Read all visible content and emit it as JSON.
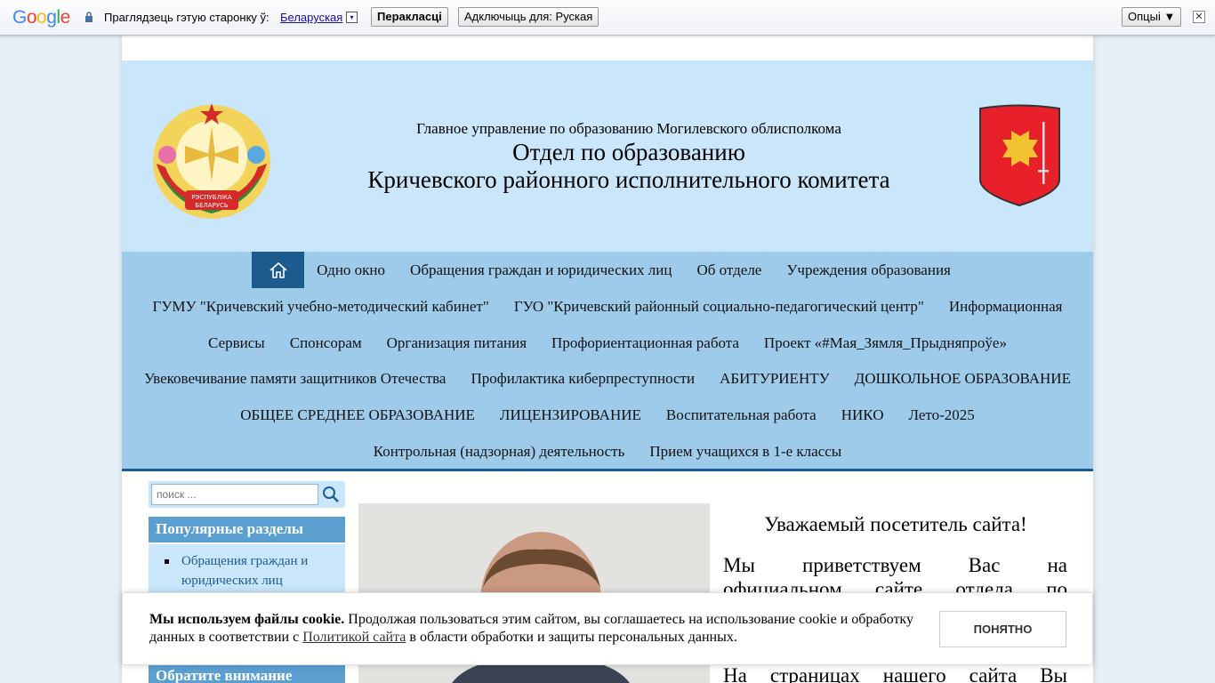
{
  "translate_bar": {
    "logo": "Google",
    "prompt": "Праглядзець гэтую старонку ў:",
    "language": "Беларуская",
    "language_drop": "▾",
    "translate_button": "Перакласці",
    "disable_button": "Адключыць для: Руская",
    "options_button": "Опцыі ▼",
    "close": "✕"
  },
  "header": {
    "subtitle": "Главное управление по образованию Могилевского облисполкома",
    "title_line1": "Отдел по образованию",
    "title_line2": "Кричевского районного исполнительного комитета",
    "emblem_text": "РЭСПУБЛІКА БЕЛАРУСЬ"
  },
  "nav": {
    "row1": [
      "Одно окно",
      "Обращения граждан и юридических лиц",
      "Об отделе",
      "Учреждения образования"
    ],
    "row2": [
      "ГУМУ \"Кричевский учебно-методический кабинет\"",
      "ГУО \"Кричевский районный социально-педагогический центр\"",
      "Информационная"
    ],
    "row3": [
      "Сервисы",
      "Спонсорам",
      "Организация питания",
      "Профориентационная работа",
      "Проект «#Мая_Зямля_Прыдняпроўе»"
    ],
    "row4": [
      "Увековечивание памяти защитников Отечества",
      "Профилактика киберпреступности",
      "АБИТУРИЕНТУ",
      "ДОШКОЛЬНОЕ ОБРАЗОВАНИЕ"
    ],
    "row5": [
      "ОБЩЕЕ СРЕДНЕЕ ОБРАЗОВАНИЕ",
      "ЛИЦЕНЗИРОВАНИЕ",
      "Воспитательная работа",
      "НИКО",
      "Лето-2025"
    ],
    "row6": [
      "Контрольная (надзорная) деятельность",
      "Прием учащихся в 1-е классы"
    ]
  },
  "sidebar": {
    "search_placeholder": "поиск ...",
    "popular_title": "Популярные разделы",
    "popular_items": [
      "Обращения граждан и юридических лиц"
    ],
    "attention_title": "Обратите внимание"
  },
  "main": {
    "welcome_title": "Уважаемый посетитель сайта!",
    "line1": "Мы приветствуем Вас на",
    "line2": "официальном сайте отдела по",
    "line3": "На страницах нашего сайта Вы"
  },
  "cookie": {
    "bold": "Мы используем файлы cookie.",
    "text_before_link": " Продолжая пользоваться этим сайтом, вы соглашаетесь на использование cookie и обработку данных в соответствии с ",
    "link": "Политикой сайта",
    "text_after_link": " в области обработки и защиты персональных данных.",
    "button": "ПОНЯТНО"
  },
  "colors": {
    "header_bg": "#c9e6fb",
    "nav_bg": "#9fcbeb",
    "nav_accent": "#1d5b8f",
    "sidebar_head": "#5b9fd0"
  }
}
